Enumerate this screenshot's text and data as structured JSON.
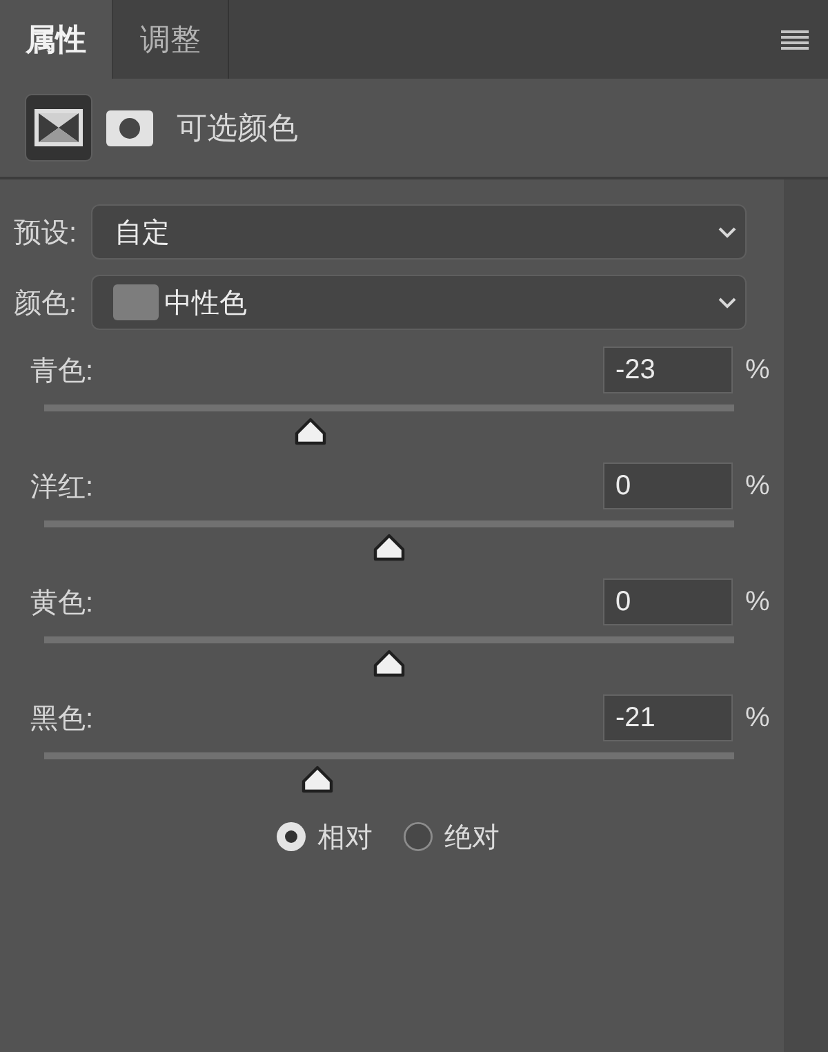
{
  "tabs": [
    {
      "label": "属性",
      "selected": true
    },
    {
      "label": "调整",
      "selected": false
    }
  ],
  "header": {
    "modes": [
      {
        "kind": "adjustment",
        "selected": true
      },
      {
        "kind": "mask",
        "selected": false
      }
    ],
    "title": "可选颜色"
  },
  "preset": {
    "label": "预设:",
    "value": "自定"
  },
  "colors": {
    "label": "颜色:",
    "value": "中性色"
  },
  "sliders": [
    {
      "label": "青色:",
      "value": "-23",
      "unit": "%",
      "level": 0.385
    },
    {
      "label": "洋红:",
      "value": "0",
      "unit": "%",
      "level": 0.5
    },
    {
      "label": "黄色:",
      "value": "0",
      "unit": "%",
      "level": 0.5
    },
    {
      "label": "黑色:",
      "value": "-21",
      "unit": "%",
      "level": 0.395
    }
  ],
  "method": [
    {
      "label": "相对",
      "selected": true
    },
    {
      "label": "绝对",
      "selected": false
    }
  ]
}
